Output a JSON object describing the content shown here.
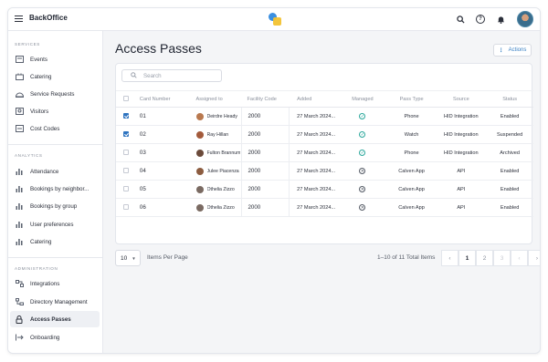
{
  "app": {
    "title": "BackOffice"
  },
  "sidebar": {
    "sections": [
      {
        "label": "SERVICES"
      },
      {
        "label": "ANALYTICS"
      },
      {
        "label": "ADMINISTRATION"
      }
    ],
    "items": [
      {
        "label": "Events",
        "icon": "events-icon"
      },
      {
        "label": "Catering",
        "icon": "catering-icon"
      },
      {
        "label": "Service Requests",
        "icon": "service-requests-icon"
      },
      {
        "label": "Visitors",
        "icon": "visitors-icon"
      },
      {
        "label": "Cost Codes",
        "icon": "cost-codes-icon"
      },
      {
        "label": "Attendance",
        "icon": "bar-chart-icon"
      },
      {
        "label": "Bookings by neighbor...",
        "icon": "bar-chart-icon"
      },
      {
        "label": "Bookings by group",
        "icon": "bar-chart-icon"
      },
      {
        "label": "User preferences",
        "icon": "bar-chart-icon"
      },
      {
        "label": "Catering",
        "icon": "bar-chart-icon"
      },
      {
        "label": "Integrations",
        "icon": "integrations-icon"
      },
      {
        "label": "Directory Management",
        "icon": "directory-icon"
      },
      {
        "label": "Access Passes",
        "icon": "access-pass-icon"
      },
      {
        "label": "Onboarding",
        "icon": "onboarding-icon"
      }
    ],
    "active_item": "Access Passes"
  },
  "main": {
    "title": "Access Passes",
    "actions_label": "Actions",
    "search": {
      "placeholder": "Search",
      "value": ""
    },
    "columns": [
      "Card Number",
      "Assigned to",
      "Facility Code",
      "Added",
      "Managed",
      "Pass Type",
      "Source",
      "Status"
    ],
    "rows": [
      {
        "checked": true,
        "card": "01",
        "assigned": "Deirdre Heady",
        "facility": "2000",
        "added": "27 March 2024...",
        "managed": true,
        "pass_type": "Phone",
        "source": "HID Integration",
        "status": "Enabled",
        "avatar_color": "#b9794f"
      },
      {
        "checked": true,
        "card": "02",
        "assigned": "Ray Hillan",
        "facility": "2000",
        "added": "27 March 2024...",
        "managed": true,
        "pass_type": "Watch",
        "source": "HID Integration",
        "status": "Suspended",
        "avatar_color": "#a35a3b"
      },
      {
        "checked": false,
        "card": "03",
        "assigned": "Fulton Brannum",
        "facility": "2000",
        "added": "27 March 2024...",
        "managed": true,
        "pass_type": "Phone",
        "source": "HID Integration",
        "status": "Archived",
        "avatar_color": "#6b4a3a"
      },
      {
        "checked": false,
        "card": "04",
        "assigned": "Julee Piacenza",
        "facility": "2000",
        "added": "27 March 2024...",
        "managed": false,
        "pass_type": "Calven App",
        "source": "API",
        "status": "Enabled",
        "avatar_color": "#8c5c40"
      },
      {
        "checked": false,
        "card": "05",
        "assigned": "Othelia Zizzo",
        "facility": "2000",
        "added": "27 March 2024...",
        "managed": false,
        "pass_type": "Calven App",
        "source": "API",
        "status": "Enabled",
        "avatar_color": "#7a6a62"
      },
      {
        "checked": false,
        "card": "06",
        "assigned": "Othelia Zizzo",
        "facility": "2000",
        "added": "27 March 2024...",
        "managed": false,
        "pass_type": "Calven App",
        "source": "API",
        "status": "Enabled",
        "avatar_color": "#7a6a62"
      }
    ],
    "pagination": {
      "per_page_value": "10",
      "per_page_label": "Items Per Page",
      "total_text": "1–10 of 11 Total Items",
      "pages": [
        "1",
        "2",
        "3"
      ],
      "current_page": "1"
    }
  },
  "colors": {
    "accent": "#2f74c0",
    "managed_check": "#2aa79b"
  }
}
